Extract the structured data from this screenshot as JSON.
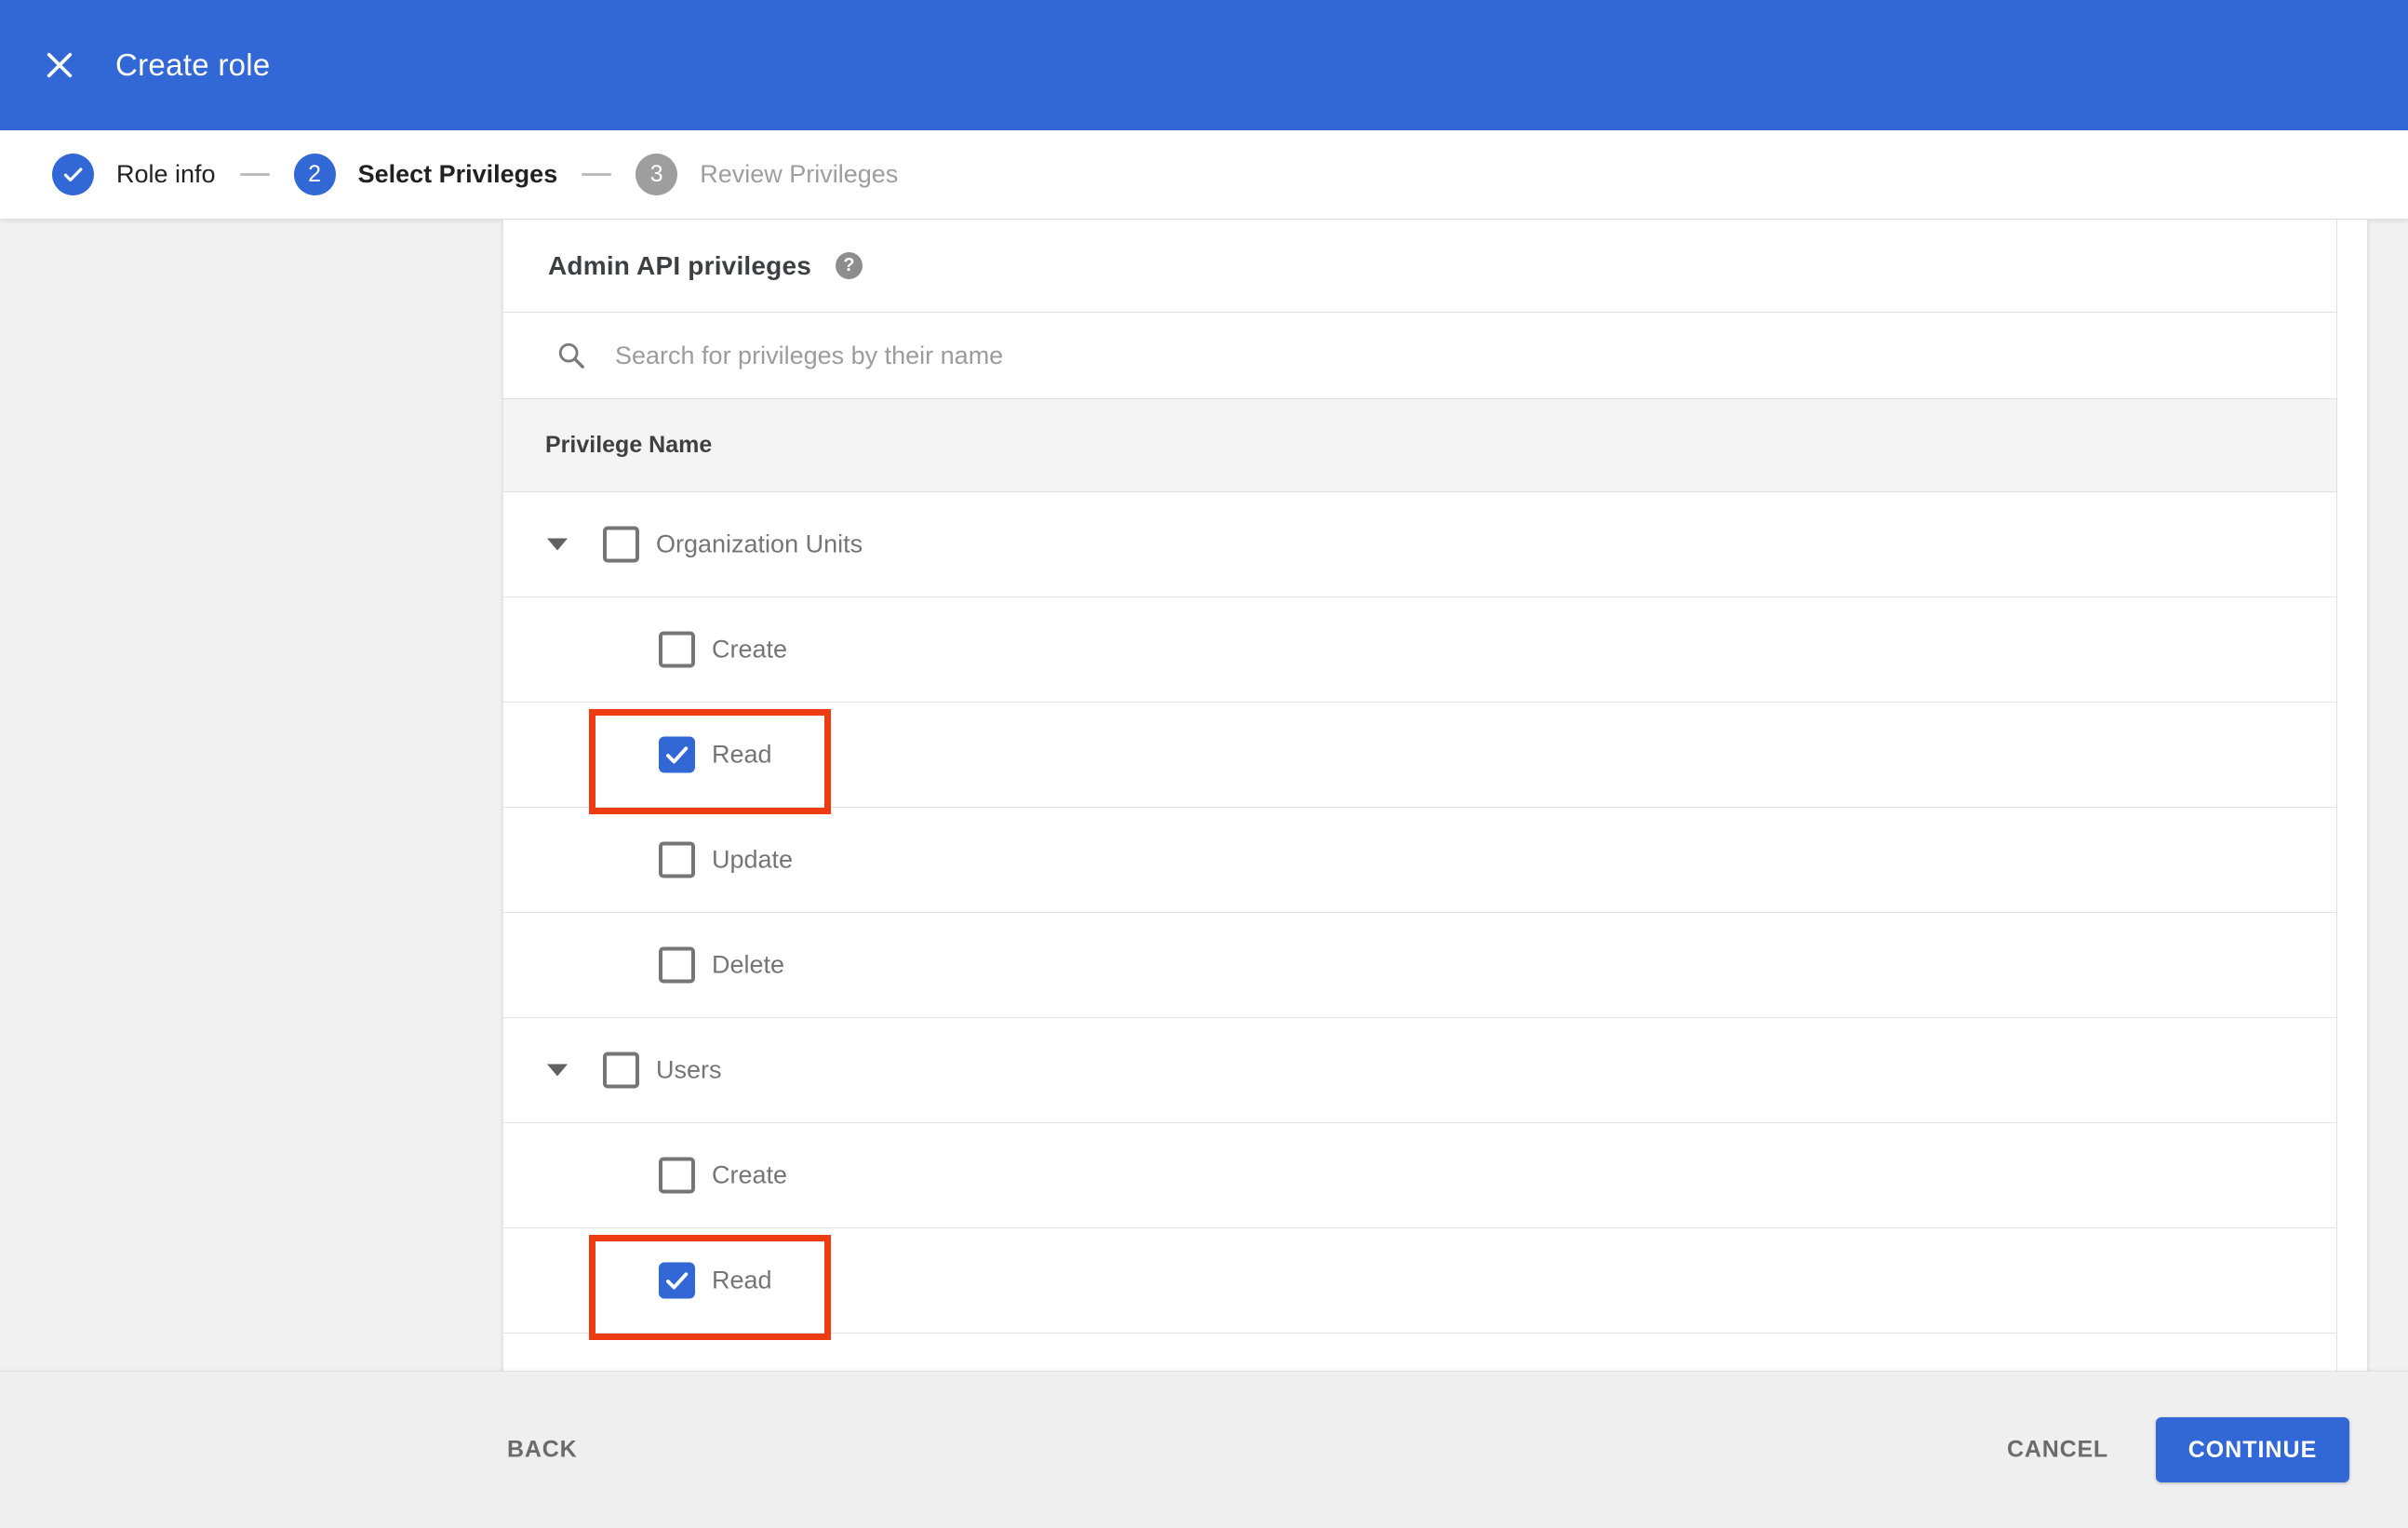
{
  "header": {
    "title": "Create role",
    "bg_color": "#3267d6"
  },
  "stepper": {
    "steps": [
      {
        "number": "1",
        "label": "Role info",
        "state": "completed"
      },
      {
        "number": "2",
        "label": "Select Privileges",
        "state": "current"
      },
      {
        "number": "3",
        "label": "Review Privileges",
        "state": "upcoming"
      }
    ]
  },
  "panel": {
    "heading": "Admin API privileges",
    "search_placeholder": "Search for privileges by their name",
    "column_header": "Privilege Name"
  },
  "privileges": [
    {
      "label": "Organization Units",
      "level": "parent",
      "checked": false,
      "expanded": true
    },
    {
      "label": "Create",
      "level": "child",
      "checked": false
    },
    {
      "label": "Read",
      "level": "child",
      "checked": true,
      "highlighted": true
    },
    {
      "label": "Update",
      "level": "child",
      "checked": false
    },
    {
      "label": "Delete",
      "level": "child",
      "checked": false
    },
    {
      "label": "Users",
      "level": "parent",
      "checked": false,
      "expanded": true
    },
    {
      "label": "Create",
      "level": "child",
      "checked": false
    },
    {
      "label": "Read",
      "level": "child",
      "checked": true,
      "highlighted": true
    }
  ],
  "footer": {
    "back": "BACK",
    "cancel": "CANCEL",
    "continue": "CONTINUE"
  },
  "icons": {
    "close": "x-icon",
    "step_completed": "checkmark-icon",
    "help_glyph": "?",
    "search": "magnifier-icon",
    "expand": "triangle-down-icon",
    "checkbox_check": "checkmark-icon"
  },
  "colors": {
    "accent_blue": "#3267d6",
    "highlight_red": "#ee3c12",
    "step_inactive_gray": "#9e9e9e",
    "label_gray": "#757575"
  }
}
